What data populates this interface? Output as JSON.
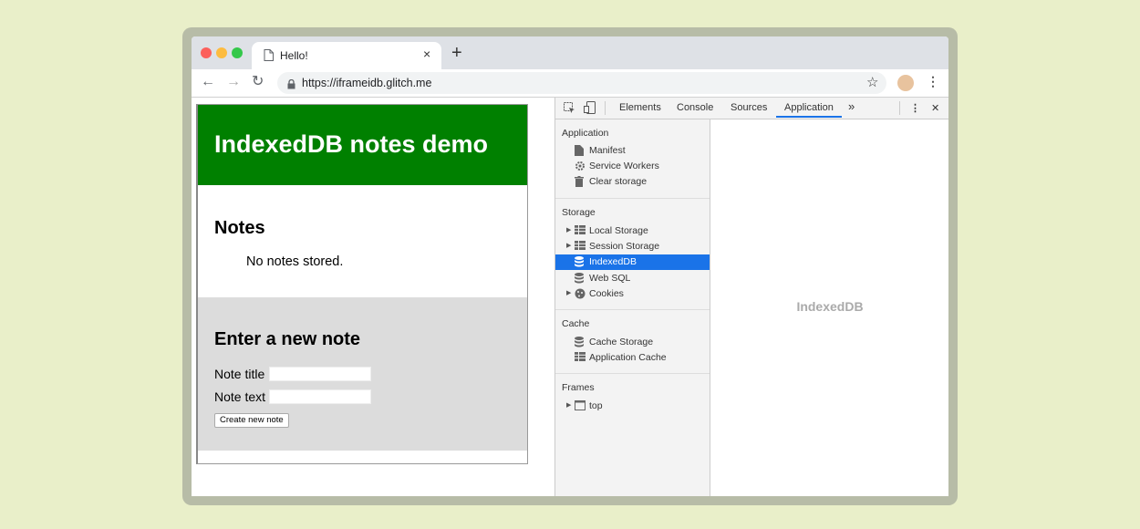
{
  "browser": {
    "tab_title": "Hello!",
    "tab_close": "×",
    "new_tab": "+",
    "url": "https://iframeidb.glitch.me",
    "back": "←",
    "forward": "→",
    "reload": "↻",
    "star": "☆",
    "menu": "⋮",
    "traffic_colors": [
      "#fc605c",
      "#fdbc40",
      "#34c84a"
    ]
  },
  "page": {
    "hero_title": "IndexedDB notes demo",
    "notes_heading": "Notes",
    "no_notes": "No notes stored.",
    "form_heading": "Enter a new note",
    "note_title_label": "Note title",
    "note_text_label": "Note text",
    "create_button": "Create new note",
    "hero_color": "#008000"
  },
  "devtools": {
    "tabs": [
      "Elements",
      "Console",
      "Sources",
      "Application"
    ],
    "active_tab": "Application",
    "more_tabs": "»",
    "menu": "⋮",
    "close": "✕",
    "sections": {
      "application": {
        "title": "Application",
        "items": [
          "Manifest",
          "Service Workers",
          "Clear storage"
        ]
      },
      "storage": {
        "title": "Storage",
        "items": [
          "Local Storage",
          "Session Storage",
          "IndexedDB",
          "Web SQL",
          "Cookies"
        ]
      },
      "cache": {
        "title": "Cache",
        "items": [
          "Cache Storage",
          "Application Cache"
        ]
      },
      "frames": {
        "title": "Frames",
        "items": [
          "top"
        ]
      }
    },
    "selected_item": "IndexedDB",
    "main_placeholder": "IndexedDB",
    "accent": "#1a73e8"
  }
}
